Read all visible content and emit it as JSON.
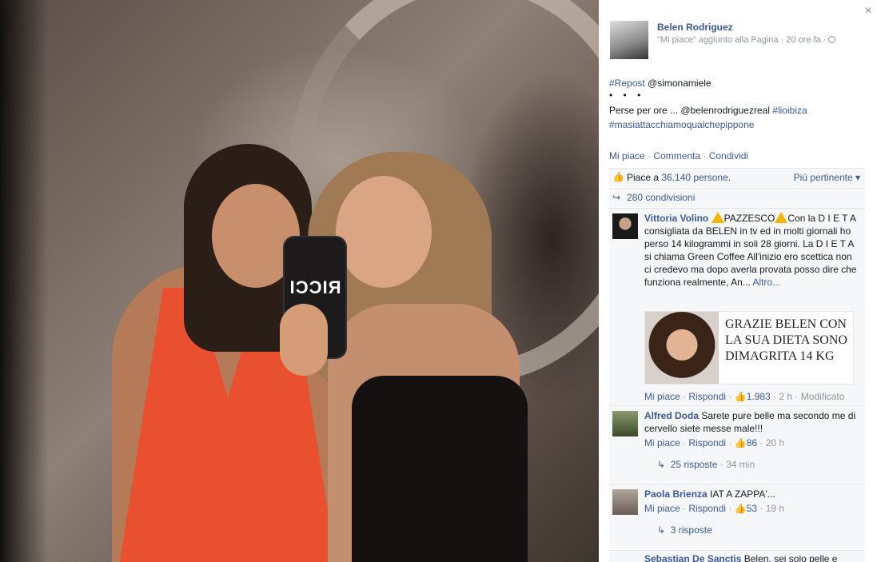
{
  "close_glyph": "×",
  "photo": {
    "phone_case_text": "RICCI"
  },
  "post": {
    "author": "Belen Rodriguez",
    "meta": "\"Mi piace\" aggiunto alla Pagina · 20 ore fa ·",
    "repost_tag": "#Repost",
    "repost_user": " @simonamiele",
    "dots": "• • •",
    "body": "Perse per ore ... @belenrodriguezreal ",
    "tag1": "#lioibiza",
    "tag2": "#masiattacchiamoqualchepippone"
  },
  "actions": {
    "like": "Mi piace",
    "comment": "Commenta",
    "share": "Condividi",
    "sep": " · "
  },
  "likes": {
    "prefix": "Piace a ",
    "count": "36.140 persone",
    "suffix": ".",
    "order": "Più pertinente ▾"
  },
  "shares": {
    "text": "280 condivisioni"
  },
  "comments": [
    {
      "name": "Vittoria Volino",
      "text_a": "PAZZESCO",
      "text_b": "Con la D I E T A consigliata da BELEN in tv ed in molti giornali ho perso 14 kilogrammi in soli 28 giorni. La D I E T A si chiama Green Coffee All'inizio ero scettica non ci credevo ma dopo averla provata posso dire che funziona realmente, An... ",
      "more": "Altro...",
      "attach_caption": "GRAZIE BELEN CON LA SUA DIETA SONO DIMAGRITA 14 KG",
      "like": "Mi piace",
      "reply": "Rispondi",
      "likes": "1.983",
      "time": "2 h",
      "edited": "Modificato"
    },
    {
      "name": "Alfred Doda",
      "text": "Sarete pure belle ma secondo me di cervello siete messe male!!!",
      "like": "Mi piace",
      "reply": "Rispondi",
      "likes": "86",
      "time": "20 h",
      "replies": "25 risposte",
      "replies_time": "34 min"
    },
    {
      "name": "Paola Brienza",
      "text": "IAT A ZAPPA'...",
      "like": "Mi piace",
      "reply": "Rispondi",
      "likes": "53",
      "time": "19 h",
      "replies": "3 risposte"
    },
    {
      "name": "Sebastian De Sanctis",
      "text": "Belen, sei solo pelle e"
    }
  ],
  "icons": {
    "thumb": "thumbs-up-icon",
    "share": "share-arrow-icon",
    "reply": "reply-arrow-icon",
    "warning": "warning-icon",
    "globe": "globe-icon"
  }
}
